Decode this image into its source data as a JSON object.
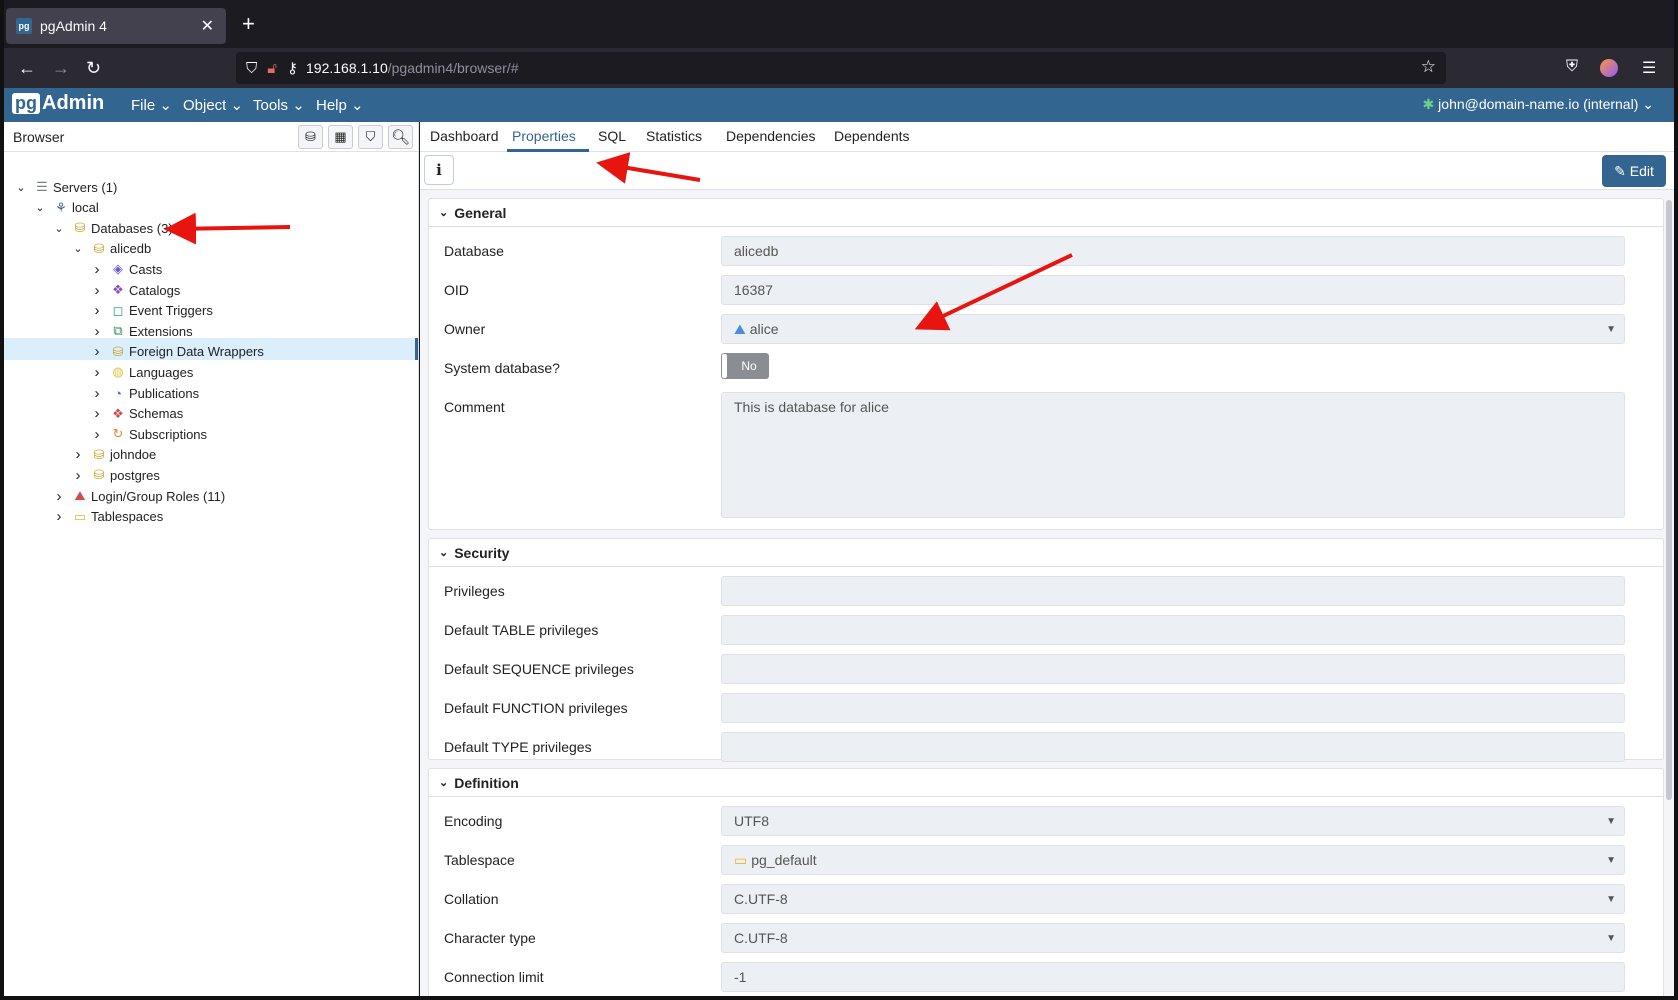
{
  "firefox": {
    "tab_title": "pgAdmin 4",
    "favicon_text": "pg",
    "url_host": "192.168.1.10",
    "url_path": "/pgadmin4/browser/#"
  },
  "pgadmin": {
    "logo_prefix": "pg",
    "logo_suffix": "Admin",
    "menus": [
      "File",
      "Object",
      "Tools",
      "Help"
    ],
    "user": "john@domain-name.io (internal)"
  },
  "browser": {
    "title": "Browser",
    "tree": [
      {
        "label": "Servers (1)",
        "icon": "servers-icon",
        "level": 0,
        "expanded": true
      },
      {
        "label": "local",
        "icon": "elephant-icon",
        "level": 1,
        "expanded": true
      },
      {
        "label": "Databases (3)",
        "icon": "databases-icon",
        "level": 2,
        "expanded": true
      },
      {
        "label": "alicedb",
        "icon": "database-icon",
        "level": 3,
        "expanded": true,
        "selected": true
      },
      {
        "label": "Casts",
        "icon": "casts-icon",
        "level": 4,
        "expanded": false
      },
      {
        "label": "Catalogs",
        "icon": "catalogs-icon",
        "level": 4,
        "expanded": false
      },
      {
        "label": "Event Triggers",
        "icon": "event-triggers-icon",
        "level": 4,
        "expanded": false
      },
      {
        "label": "Extensions",
        "icon": "extensions-icon",
        "level": 4,
        "expanded": false
      },
      {
        "label": "Foreign Data Wrappers",
        "icon": "fdw-icon",
        "level": 4,
        "expanded": false
      },
      {
        "label": "Languages",
        "icon": "languages-icon",
        "level": 4,
        "expanded": false
      },
      {
        "label": "Publications",
        "icon": "publications-icon",
        "level": 4,
        "expanded": false
      },
      {
        "label": "Schemas",
        "icon": "schemas-icon",
        "level": 4,
        "expanded": false
      },
      {
        "label": "Subscriptions",
        "icon": "subscriptions-icon",
        "level": 4,
        "expanded": false
      },
      {
        "label": "johndoe",
        "icon": "database-icon",
        "level": 3,
        "expanded": false
      },
      {
        "label": "postgres",
        "icon": "database-icon",
        "level": 3,
        "expanded": false
      },
      {
        "label": "Login/Group Roles (11)",
        "icon": "roles-icon",
        "level": 2,
        "expanded": false
      },
      {
        "label": "Tablespaces",
        "icon": "tablespaces-icon",
        "level": 2,
        "expanded": false
      }
    ]
  },
  "panel": {
    "tabs": [
      "Dashboard",
      "Properties",
      "SQL",
      "Statistics",
      "Dependencies",
      "Dependents"
    ],
    "active_tab": "Properties",
    "info_label": "i",
    "edit_label": "Edit"
  },
  "general": {
    "title": "General",
    "database_label": "Database",
    "database_value": "alicedb",
    "oid_label": "OID",
    "oid_value": "16387",
    "owner_label": "Owner",
    "owner_value": "alice",
    "sysdb_label": "System database?",
    "sysdb_value": "No",
    "comment_label": "Comment",
    "comment_value": "This is database for alice"
  },
  "security": {
    "title": "Security",
    "rows": [
      {
        "label": "Privileges",
        "value": ""
      },
      {
        "label": "Default TABLE privileges",
        "value": ""
      },
      {
        "label": "Default SEQUENCE privileges",
        "value": ""
      },
      {
        "label": "Default FUNCTION privileges",
        "value": ""
      },
      {
        "label": "Default TYPE privileges",
        "value": ""
      }
    ]
  },
  "definition": {
    "title": "Definition",
    "rows": [
      {
        "label": "Encoding",
        "value": "UTF8"
      },
      {
        "label": "Tablespace",
        "value": "pg_default"
      },
      {
        "label": "Collation",
        "value": "C.UTF-8"
      },
      {
        "label": "Character type",
        "value": "C.UTF-8"
      },
      {
        "label": "Connection limit",
        "value": "-1"
      }
    ]
  },
  "colors": {
    "pgadmin_blue": "#326690",
    "annotation_red": "#e8140f",
    "selection": "#dbeefb"
  }
}
